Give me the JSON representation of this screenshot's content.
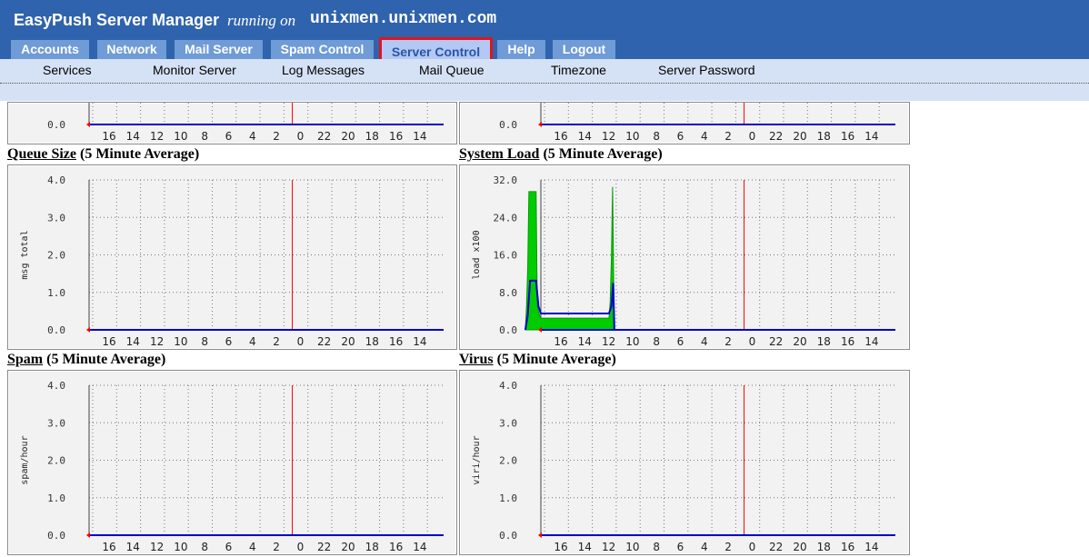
{
  "header": {
    "title": "EasyPush Server Manager",
    "running_on": "running on",
    "hostname": "unixmen.unixmen.com"
  },
  "tabs": [
    {
      "label": "Accounts",
      "active": false
    },
    {
      "label": "Network",
      "active": false
    },
    {
      "label": "Mail Server",
      "active": false
    },
    {
      "label": "Spam Control",
      "active": false
    },
    {
      "label": "Server Control",
      "active": true
    },
    {
      "label": "Help",
      "active": false
    },
    {
      "label": "Logout",
      "active": false
    }
  ],
  "subnav": [
    "Services",
    "Monitor Server",
    "Log Messages",
    "Mail Queue",
    "Timezone",
    "Server Password"
  ],
  "colors": {
    "header": "#2f63ad",
    "tab": "#6f9bd6",
    "active_tab": "#b4c8f4",
    "active_outline": "#e1141e",
    "subnav": "#d5e2f5",
    "series_line": "#0000cc",
    "series_fill": "#00cc00",
    "now_marker": "#ff0000"
  },
  "graphs": [
    {
      "id": "top-left",
      "title_link": "",
      "title_rest": "",
      "ylabel": ""
    },
    {
      "id": "top-right",
      "title_link": "",
      "title_rest": "",
      "ylabel": ""
    },
    {
      "id": "queue",
      "title_link": "Queue Size",
      "title_rest": " (5 Minute Average)",
      "ylabel": "msg total"
    },
    {
      "id": "load",
      "title_link": "System Load",
      "title_rest": " (5 Minute Average)",
      "ylabel": "load x100"
    },
    {
      "id": "spam",
      "title_link": "Spam",
      "title_rest": " (5 Minute Average)",
      "ylabel": "spam/hour"
    },
    {
      "id": "virus",
      "title_link": "Virus",
      "title_rest": " (5 Minute Average)",
      "ylabel": "viri/hour"
    }
  ],
  "chart_data": [
    {
      "type": "area",
      "id": "top-left",
      "x_tick_labels": [
        "16",
        "14",
        "12",
        "10",
        "8",
        "6",
        "4",
        "2",
        "0",
        "22",
        "20",
        "18",
        "16",
        "14"
      ],
      "y_ticks": [
        {
          "v": 0,
          "label": "0.0"
        }
      ],
      "visible_y_min": 0,
      "series": []
    },
    {
      "type": "area",
      "id": "top-right",
      "x_tick_labels": [
        "16",
        "14",
        "12",
        "10",
        "8",
        "6",
        "4",
        "2",
        "0",
        "22",
        "20",
        "18",
        "16",
        "14"
      ],
      "y_ticks": [
        {
          "v": 0,
          "label": "0.0"
        }
      ],
      "visible_y_min": 0,
      "series": []
    },
    {
      "type": "area",
      "id": "queue",
      "title": "Queue Size (5 Minute Average)",
      "ylabel": "msg total",
      "ylim": [
        0,
        4
      ],
      "y_ticks": [
        {
          "v": 0,
          "label": "0.0"
        },
        {
          "v": 1,
          "label": "1.0"
        },
        {
          "v": 2,
          "label": "2.0"
        },
        {
          "v": 3,
          "label": "3.0"
        },
        {
          "v": 4,
          "label": "4.0"
        }
      ],
      "x_tick_labels": [
        "16",
        "14",
        "12",
        "10",
        "8",
        "6",
        "4",
        "2",
        "0",
        "22",
        "20",
        "18",
        "16",
        "14"
      ],
      "series": [
        {
          "values": []
        }
      ]
    },
    {
      "type": "area",
      "id": "load",
      "title": "System Load (5 Minute Average)",
      "ylabel": "load x100",
      "ylim": [
        0,
        32
      ],
      "y_ticks": [
        {
          "v": 0,
          "label": "0.0"
        },
        {
          "v": 8,
          "label": "8.0"
        },
        {
          "v": 16,
          "label": "16.0"
        },
        {
          "v": 24,
          "label": "24.0"
        },
        {
          "v": 32,
          "label": "32.0"
        }
      ],
      "x_tick_labels": [
        "16",
        "14",
        "12",
        "10",
        "8",
        "6",
        "4",
        "2",
        "0",
        "22",
        "20",
        "18",
        "16",
        "14"
      ],
      "series": [
        {
          "style": "area",
          "color": "#00cc00",
          "points": [
            [
              -18.3,
              0
            ],
            [
              -18.2,
              5
            ],
            [
              -18.1,
              13
            ],
            [
              -18.0,
              29.5
            ],
            [
              -17.4,
              29.5
            ],
            [
              -17.3,
              5
            ],
            [
              -17.1,
              3
            ],
            [
              -17.0,
              2.5
            ],
            [
              -11.3,
              2.5
            ],
            [
              -11.2,
              6
            ],
            [
              -11.1,
              15
            ],
            [
              -11.0,
              30.5
            ],
            [
              -10.9,
              8
            ],
            [
              -10.85,
              0
            ]
          ]
        },
        {
          "style": "line",
          "color": "#0000cc",
          "points": [
            [
              -18.3,
              0
            ],
            [
              -18.1,
              3
            ],
            [
              -17.9,
              10.5
            ],
            [
              -17.4,
              10.5
            ],
            [
              -17.2,
              5
            ],
            [
              -17.0,
              3.5
            ],
            [
              -11.3,
              3.5
            ],
            [
              -11.1,
              5
            ],
            [
              -10.95,
              10
            ],
            [
              -10.85,
              0
            ]
          ]
        }
      ]
    },
    {
      "type": "area",
      "id": "spam",
      "title": "Spam (5 Minute Average)",
      "ylabel": "spam/hour",
      "ylim": [
        0,
        4
      ],
      "y_ticks": [
        {
          "v": 0,
          "label": "0.0"
        },
        {
          "v": 1,
          "label": "1.0"
        },
        {
          "v": 2,
          "label": "2.0"
        },
        {
          "v": 3,
          "label": "3.0"
        },
        {
          "v": 4,
          "label": "4.0"
        }
      ],
      "x_tick_labels": [
        "16",
        "14",
        "12",
        "10",
        "8",
        "6",
        "4",
        "2",
        "0",
        "22",
        "20",
        "18",
        "16",
        "14"
      ],
      "series": [
        {
          "values": []
        }
      ]
    },
    {
      "type": "area",
      "id": "virus",
      "title": "Virus (5 Minute Average)",
      "ylabel": "viri/hour",
      "ylim": [
        0,
        4
      ],
      "y_ticks": [
        {
          "v": 0,
          "label": "0.0"
        },
        {
          "v": 1,
          "label": "1.0"
        },
        {
          "v": 2,
          "label": "2.0"
        },
        {
          "v": 3,
          "label": "3.0"
        },
        {
          "v": 4,
          "label": "4.0"
        }
      ],
      "x_tick_labels": [
        "16",
        "14",
        "12",
        "10",
        "8",
        "6",
        "4",
        "2",
        "0",
        "22",
        "20",
        "18",
        "16",
        "14"
      ],
      "series": [
        {
          "values": []
        }
      ]
    }
  ]
}
